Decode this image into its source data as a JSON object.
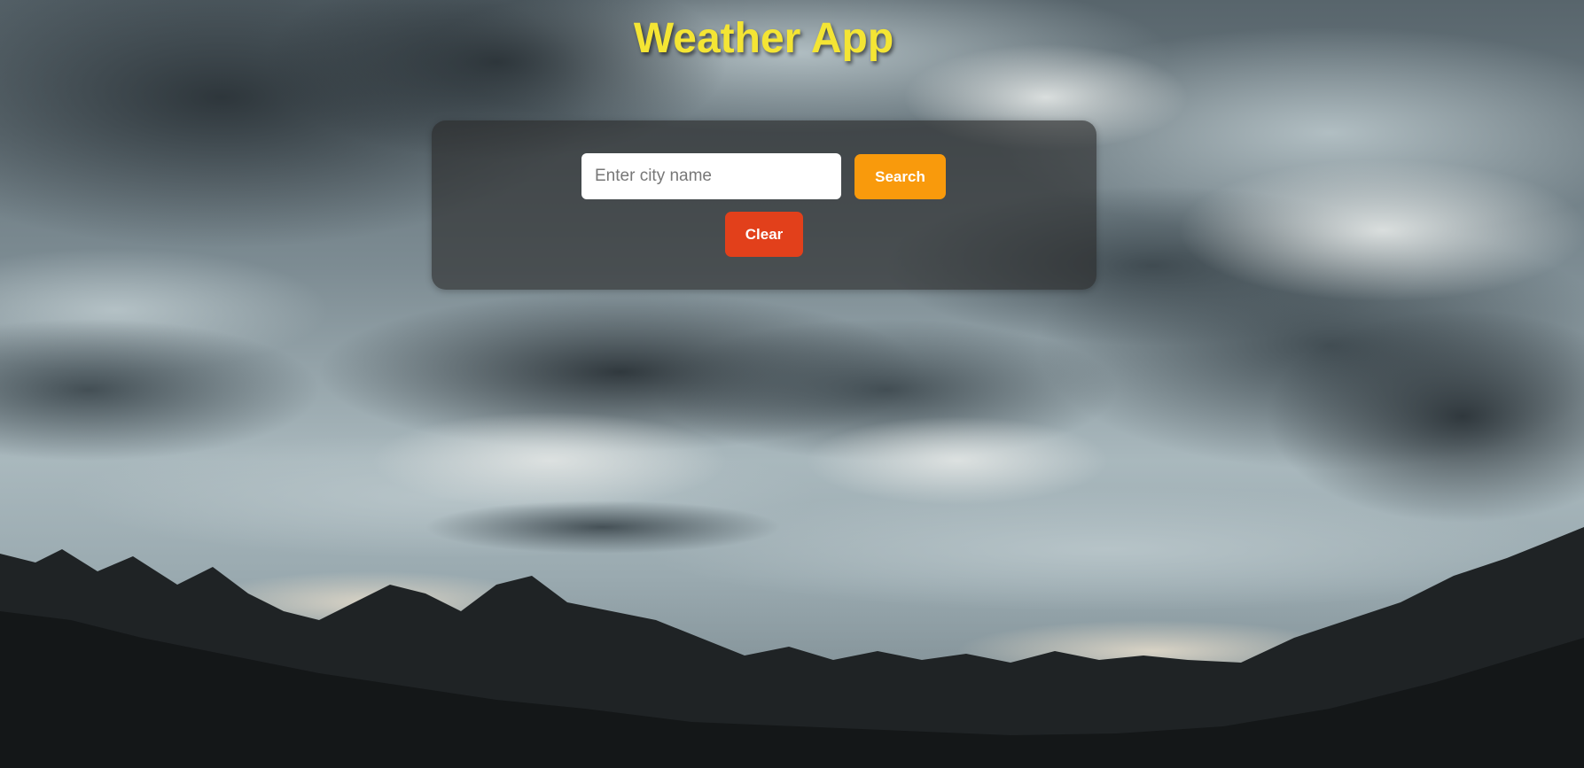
{
  "app": {
    "title": "Weather App"
  },
  "search": {
    "placeholder": "Enter city name",
    "value": "",
    "search_label": "Search",
    "clear_label": "Clear"
  },
  "colors": {
    "title": "#f4e534",
    "search_button": "#f99a0c",
    "clear_button": "#e2401b",
    "card_background": "rgba(40,40,40,0.62)"
  },
  "background": {
    "description_icon": "stormy-mountain-landscape"
  }
}
